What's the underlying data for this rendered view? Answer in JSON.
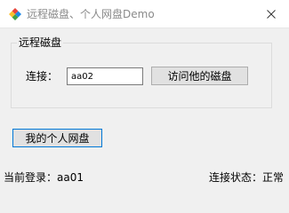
{
  "window": {
    "title": "远程磁盘、个人网盘Demo"
  },
  "icons": {
    "app": "diamond-app-icon",
    "close": "close-icon"
  },
  "colors": {
    "accent_border": "#0078d7",
    "icon_red": "#e8453c",
    "icon_blue": "#1e88e5",
    "icon_yellow": "#fbc02d",
    "icon_green": "#43a047"
  },
  "remote_group": {
    "legend": "远程磁盘",
    "connect_label": "连接：",
    "connect_value": "aa02",
    "visit_button": "访问他的磁盘"
  },
  "my_disk_button": "我的个人网盘",
  "status": {
    "current_login_label": "当前登录：",
    "current_login_user": "aa01",
    "connection_label": "连接状态：",
    "connection_value": "正常"
  }
}
